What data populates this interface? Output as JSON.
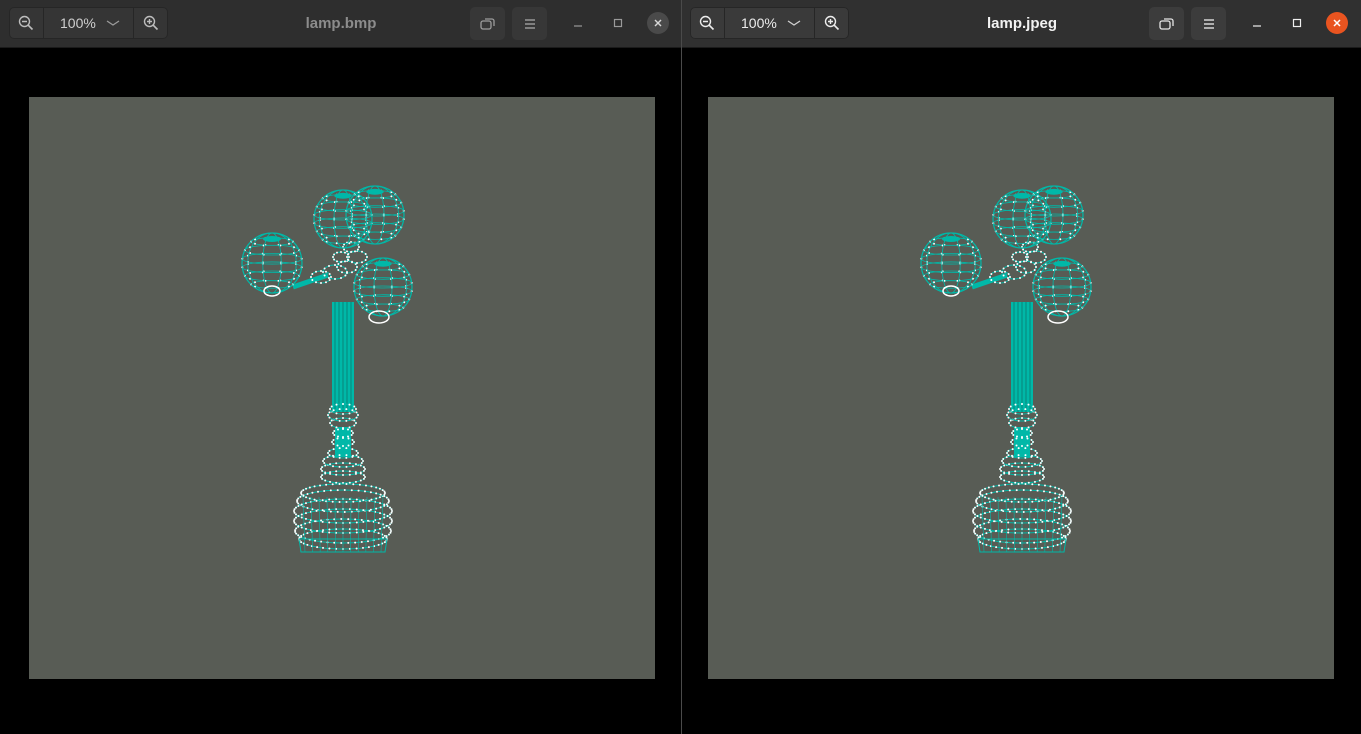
{
  "windows": [
    {
      "title": "lamp.bmp",
      "zoom_level": "100%",
      "focused": false,
      "close_color": "#4a4a4a"
    },
    {
      "title": "lamp.jpeg",
      "zoom_level": "100%",
      "focused": true,
      "close_color": "#e95420"
    }
  ],
  "icons": {
    "zoom_out": "zoom-out-icon",
    "zoom_in": "zoom-in-icon",
    "zoom_menu": "chevron-down-icon",
    "fit": "fullscreen-icon",
    "menu": "hamburger-menu-icon",
    "minimize": "minimize-icon",
    "maximize": "maximize-icon",
    "close": "close-icon"
  },
  "image_content": {
    "background_color": "#585c55",
    "wireframe_color": "#00b8a8",
    "vertex_color": "#ffffff"
  }
}
